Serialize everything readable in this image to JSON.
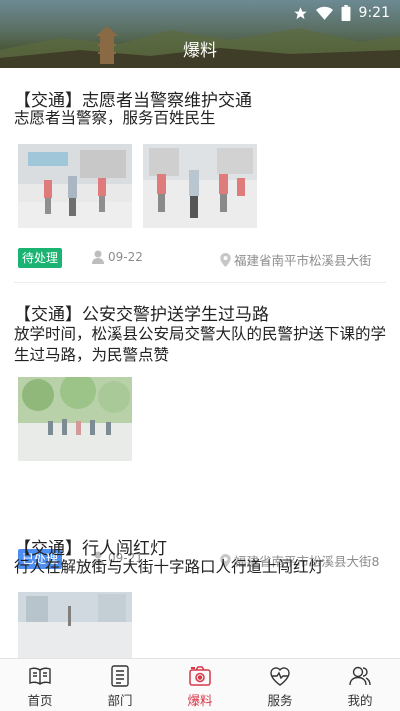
{
  "status_bar": {
    "time": "9:21"
  },
  "header": {
    "title": "爆料"
  },
  "posts": [
    {
      "title": "【交通】志愿者当警察维护交通",
      "description": "志愿者当警察，服务百姓民生",
      "status": "待处理",
      "status_color": "#1bb372",
      "date": "09-22",
      "location": "福建省南平市松溪县大街"
    },
    {
      "title": "【交通】公安交警护送学生过马路",
      "description": "放学时间，松溪县公安局交警大队的民警护送下课的学生过马路，为民警点赞",
      "status": "已处理",
      "status_color": "#4d8ef0",
      "date": "09-21",
      "location": "福建省南平市松溪县大街8"
    },
    {
      "title": "【交通】行人闯红灯",
      "description": "行人在解放街与大街十字路口人行道上闯红灯"
    }
  ],
  "tabbar": {
    "active_color": "#d8384a",
    "items": [
      {
        "label": "首页",
        "icon": "book-icon"
      },
      {
        "label": "部门",
        "icon": "document-icon"
      },
      {
        "label": "爆料",
        "icon": "camera-icon"
      },
      {
        "label": "服务",
        "icon": "heart-icon"
      },
      {
        "label": "我的",
        "icon": "user-icon"
      }
    ]
  }
}
